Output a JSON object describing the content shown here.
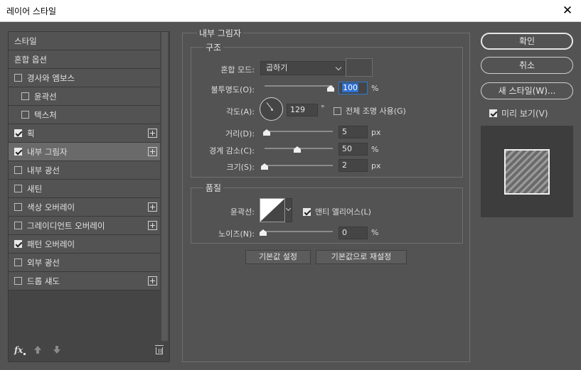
{
  "window": {
    "title": "레이어 스타일",
    "close_glyph": "✕"
  },
  "styles_panel": {
    "items": [
      {
        "label": "스타일",
        "checkbox": null,
        "checked": false,
        "plus": false,
        "indent": false,
        "selected": false
      },
      {
        "label": "혼합 옵션",
        "checkbox": null,
        "checked": false,
        "plus": false,
        "indent": false,
        "selected": false
      },
      {
        "label": "경사와 엠보스",
        "checkbox": true,
        "checked": false,
        "plus": false,
        "indent": false,
        "selected": false
      },
      {
        "label": "윤곽선",
        "checkbox": true,
        "checked": false,
        "plus": false,
        "indent": true,
        "selected": false
      },
      {
        "label": "텍스처",
        "checkbox": true,
        "checked": false,
        "plus": false,
        "indent": true,
        "selected": false
      },
      {
        "label": "획",
        "checkbox": true,
        "checked": true,
        "plus": true,
        "indent": false,
        "selected": false
      },
      {
        "label": "내부 그림자",
        "checkbox": true,
        "checked": true,
        "plus": true,
        "indent": false,
        "selected": true
      },
      {
        "label": "내부 광선",
        "checkbox": true,
        "checked": false,
        "plus": false,
        "indent": false,
        "selected": false
      },
      {
        "label": "새틴",
        "checkbox": true,
        "checked": false,
        "plus": false,
        "indent": false,
        "selected": false
      },
      {
        "label": "색상 오버레이",
        "checkbox": true,
        "checked": false,
        "plus": true,
        "indent": false,
        "selected": false
      },
      {
        "label": "그레이디언트 오버레이",
        "checkbox": true,
        "checked": false,
        "plus": true,
        "indent": false,
        "selected": false
      },
      {
        "label": "패턴 오버레이",
        "checkbox": true,
        "checked": true,
        "plus": false,
        "indent": false,
        "selected": false
      },
      {
        "label": "외부 광선",
        "checkbox": true,
        "checked": false,
        "plus": false,
        "indent": false,
        "selected": false
      },
      {
        "label": "드롭 섀도",
        "checkbox": true,
        "checked": false,
        "plus": true,
        "indent": false,
        "selected": false
      }
    ],
    "footer": {
      "fx_label": "fx"
    }
  },
  "inner_shadow": {
    "section_title": "내부 그림자",
    "structure": {
      "title": "구조",
      "blend_mode_label": "혼합 모드:",
      "blend_mode_value": "곱하기",
      "opacity_label": "불투명도(O):",
      "opacity_value": "100",
      "opacity_unit": "%",
      "angle_label": "각도(A):",
      "angle_value": "129",
      "angle_unit": "°",
      "global_light_label": "전체 조명 사용(G)",
      "global_light_checked": false,
      "distance_label": "거리(D):",
      "distance_value": "5",
      "distance_unit": "px",
      "choke_label": "경계 감소(C):",
      "choke_value": "50",
      "choke_unit": "%",
      "size_label": "크기(S):",
      "size_value": "2",
      "size_unit": "px"
    },
    "quality": {
      "title": "품질",
      "contour_label": "윤곽선:",
      "antialias_label": "앤티 앨리어스(L)",
      "antialias_checked": true,
      "noise_label": "노이즈(N):",
      "noise_value": "0",
      "noise_unit": "%"
    },
    "make_default_label": "기본값 설정",
    "reset_default_label": "기본값으로 재설정"
  },
  "actions": {
    "ok_label": "확인",
    "cancel_label": "취소",
    "new_style_label": "새 스타일(W)...",
    "preview_label": "미리 보기(V)",
    "preview_checked": true
  }
}
